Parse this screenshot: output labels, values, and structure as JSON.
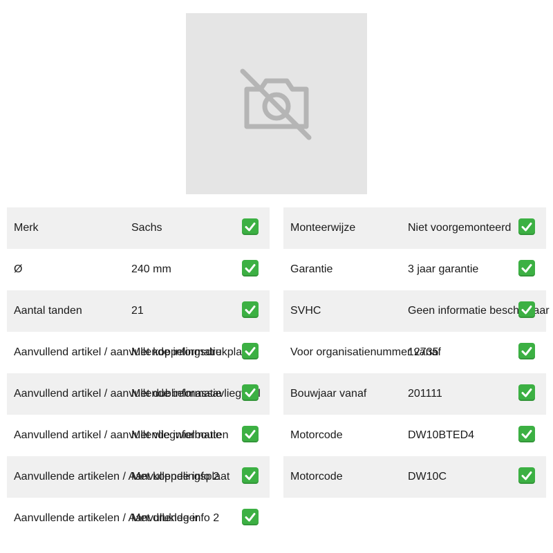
{
  "product_image": {
    "icon": "camera-off-icon",
    "background": "#e5e5e5"
  },
  "colors": {
    "row_shade": "#f0f0f0",
    "check": "#3cb043"
  },
  "specs_left": [
    {
      "label": "Merk",
      "value": "Sachs",
      "icon": "check-icon"
    },
    {
      "label": "Ø",
      "value": "240 mm",
      "icon": "check-icon"
    },
    {
      "label": "Aantal tanden",
      "value": "21",
      "icon": "check-icon"
    },
    {
      "label": "Aanvullend artikel / aanvullende informatie",
      "value": "Met koppelingsdrukplaat",
      "icon": "check-icon"
    },
    {
      "label": "Aanvullend artikel / aanvullende informatie",
      "value": "Met dubbelmassavliegwiel",
      "icon": "check-icon"
    },
    {
      "label": "Aanvullend artikel / aanvullende informatie",
      "value": "Met vliegwielbouten",
      "icon": "check-icon"
    },
    {
      "label": "Aanvullende artikelen / Aanvullende info 2",
      "value": "Met koppelingsplaat",
      "icon": "check-icon"
    },
    {
      "label": "Aanvullende artikelen / Aanvullende info 2",
      "value": "Met drukleger",
      "icon": "check-icon"
    }
  ],
  "specs_right": [
    {
      "label": "Monteerwijze",
      "value": "Niet voorgemonteerd",
      "icon": "check-icon"
    },
    {
      "label": "Garantie",
      "value": "3 jaar garantie",
      "icon": "check-icon"
    },
    {
      "label": "SVHC",
      "value": "Geen informatie beschikbaar",
      "icon": "check-icon"
    },
    {
      "label": "Voor organisatienummer vanaf",
      "value": "12735",
      "icon": "check-icon"
    },
    {
      "label": "Bouwjaar vanaf",
      "value": "201111",
      "icon": "check-icon"
    },
    {
      "label": "Motorcode",
      "value": "DW10BTED4",
      "icon": "check-icon"
    },
    {
      "label": "Motorcode",
      "value": "DW10C",
      "icon": "check-icon"
    }
  ]
}
